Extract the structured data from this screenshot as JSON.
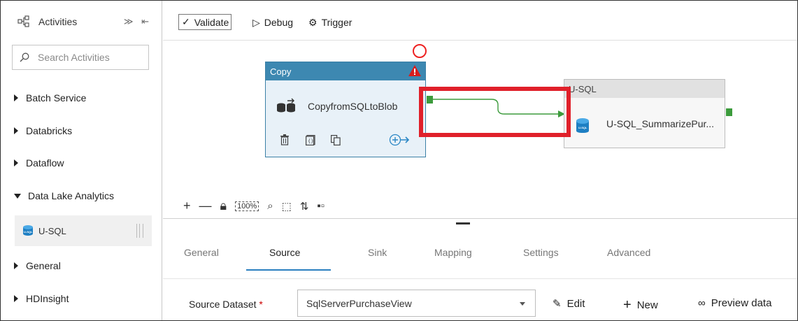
{
  "left_panel": {
    "header": "Activities",
    "search_placeholder": "Search Activities",
    "categories": [
      "Batch Service",
      "Databricks",
      "Dataflow",
      "Data Lake Analytics",
      "General",
      "HDInsight"
    ],
    "expanded_item": "U-SQL"
  },
  "toolbar": {
    "validate": "Validate",
    "debug": "Debug",
    "trigger": "Trigger"
  },
  "canvas": {
    "copy_node": {
      "title": "Copy",
      "activity_name": "CopyfromSQLtoBlob"
    },
    "usql_node": {
      "title": "U-SQL",
      "activity_name": "U-SQL_SummarizePur..."
    }
  },
  "tabs": [
    "General",
    "Source",
    "Sink",
    "Mapping",
    "Settings",
    "Advanced"
  ],
  "active_tab": "Source",
  "source": {
    "label": "Source Dataset",
    "required_mark": "*",
    "dataset_value": "SqlServerPurchaseView",
    "edit": "Edit",
    "new": "New",
    "preview": "Preview data"
  },
  "colors": {
    "accent_blue": "#3d88b1",
    "tab_underline": "#2b7fc0",
    "highlight_red": "#e0202a",
    "port_green": "#3c9b3c"
  }
}
